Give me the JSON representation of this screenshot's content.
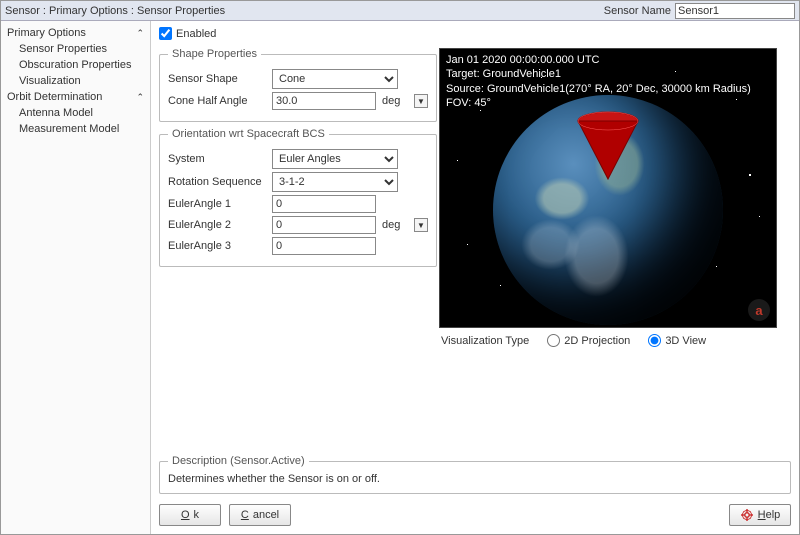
{
  "titlebar": {
    "breadcrumb": "Sensor : Primary Options : Sensor Properties",
    "sensor_name_label": "Sensor Name",
    "sensor_name_value": "Sensor1"
  },
  "sidebar": {
    "groups": [
      {
        "label": "Primary Options",
        "items": [
          "Sensor Properties",
          "Obscuration Properties",
          "Visualization"
        ]
      },
      {
        "label": "Orbit Determination",
        "items": [
          "Antenna Model",
          "Measurement Model"
        ]
      }
    ]
  },
  "enabled_label": "Enabled",
  "enabled_checked": true,
  "shape": {
    "legend": "Shape Properties",
    "sensor_shape_label": "Sensor Shape",
    "sensor_shape_value": "Cone",
    "cone_half_angle_label": "Cone Half Angle",
    "cone_half_angle_value": "30.0",
    "angle_unit": "deg"
  },
  "orientation": {
    "legend": "Orientation wrt Spacecraft BCS",
    "system_label": "System",
    "system_value": "Euler Angles",
    "rot_seq_label": "Rotation Sequence",
    "rot_seq_value": "3-1-2",
    "e1_label": "EulerAngle 1",
    "e1_value": "0",
    "e2_label": "EulerAngle 2",
    "e2_value": "0",
    "e3_label": "EulerAngle 3",
    "e3_value": "0",
    "angle_unit": "deg"
  },
  "viewport": {
    "line1": "Jan 01 2020 00:00:00.000 UTC",
    "line2": "Target: GroundVehicle1",
    "line3": "Source: GroundVehicle1(270° RA, 20° Dec, 30000 km Radius)",
    "line4": "FOV: 45°"
  },
  "vis_type": {
    "label": "Visualization Type",
    "opt2d": "2D Projection",
    "opt3d": "3D View",
    "selected": "3d"
  },
  "description": {
    "legend": "Description (Sensor.Active)",
    "text": "Determines whether the Sensor is on or off."
  },
  "buttons": {
    "ok": "Ok",
    "ok_u": "O",
    "cancel": "Cancel",
    "cancel_u": "C",
    "help": "Help",
    "help_u": "H"
  }
}
